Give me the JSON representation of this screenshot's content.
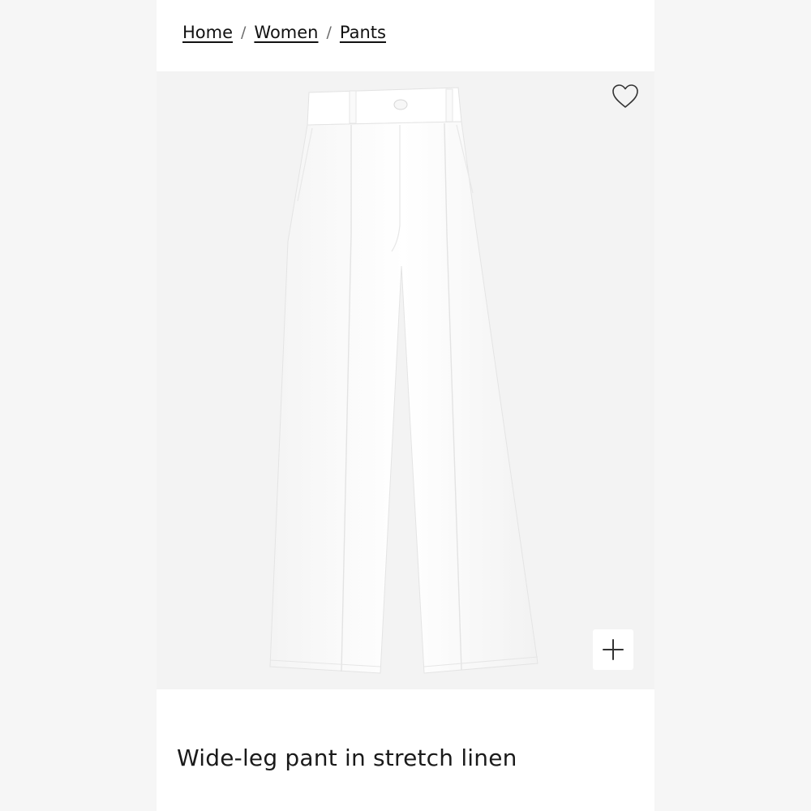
{
  "breadcrumb": {
    "items": [
      {
        "label": "Home"
      },
      {
        "label": "Women"
      },
      {
        "label": "Pants"
      }
    ],
    "separator": "/"
  },
  "product": {
    "name": "Wide-leg pant in stretch linen",
    "image_alt": "White wide-leg pleated pant",
    "colors": {
      "image_background": "#f3f3f3",
      "garment": "#ffffff",
      "text": "#1a1a1a"
    }
  },
  "actions": {
    "wishlist_icon": "heart-icon",
    "zoom_icon": "plus-icon"
  }
}
